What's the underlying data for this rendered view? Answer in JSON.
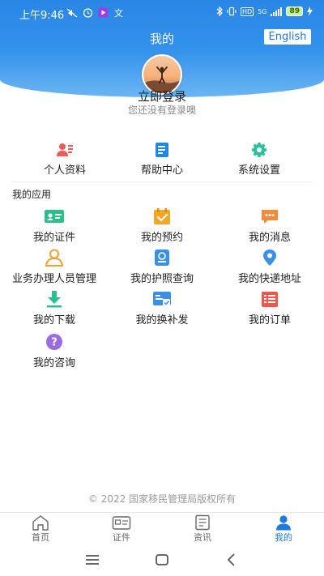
{
  "status_bar": {
    "time": "上午9:46",
    "network": "HD",
    "signal": "5G",
    "battery": "89"
  },
  "header": {
    "title": "我的",
    "english_label": "English"
  },
  "profile": {
    "login_title": "立即登录",
    "login_subtitle": "您还没有登录噢"
  },
  "quick_actions": [
    {
      "label": "个人资料",
      "icon": "person-icon"
    },
    {
      "label": "帮助中心",
      "icon": "book-icon"
    },
    {
      "label": "系统设置",
      "icon": "gear-icon"
    }
  ],
  "apps_section": {
    "title": "我的应用",
    "items": [
      {
        "label": "我的证件",
        "icon": "id-card-icon"
      },
      {
        "label": "我的预约",
        "icon": "calendar-check-icon"
      },
      {
        "label": "我的消息",
        "icon": "message-icon"
      },
      {
        "label": "业务办理人员管理",
        "icon": "user-outline-icon"
      },
      {
        "label": "我的护照查询",
        "icon": "passport-icon"
      },
      {
        "label": "我的快递地址",
        "icon": "location-pin-icon"
      },
      {
        "label": "我的下载",
        "icon": "download-icon"
      },
      {
        "label": "我的换补发",
        "icon": "reissue-card-icon"
      },
      {
        "label": "我的订单",
        "icon": "order-list-icon"
      },
      {
        "label": "我的咨询",
        "icon": "question-icon"
      }
    ]
  },
  "footer": {
    "copyright": "© 2022 国家移民管理局版权所有"
  },
  "tab_bar": {
    "tabs": [
      {
        "label": "首页",
        "icon": "home-icon"
      },
      {
        "label": "证件",
        "icon": "card-icon"
      },
      {
        "label": "资讯",
        "icon": "news-icon"
      },
      {
        "label": "我的",
        "icon": "profile-icon"
      }
    ],
    "active_index": 3
  },
  "colors": {
    "brand_blue": "#2a86e6",
    "active_tab": "#1f7ae0",
    "text_muted": "#888888"
  }
}
